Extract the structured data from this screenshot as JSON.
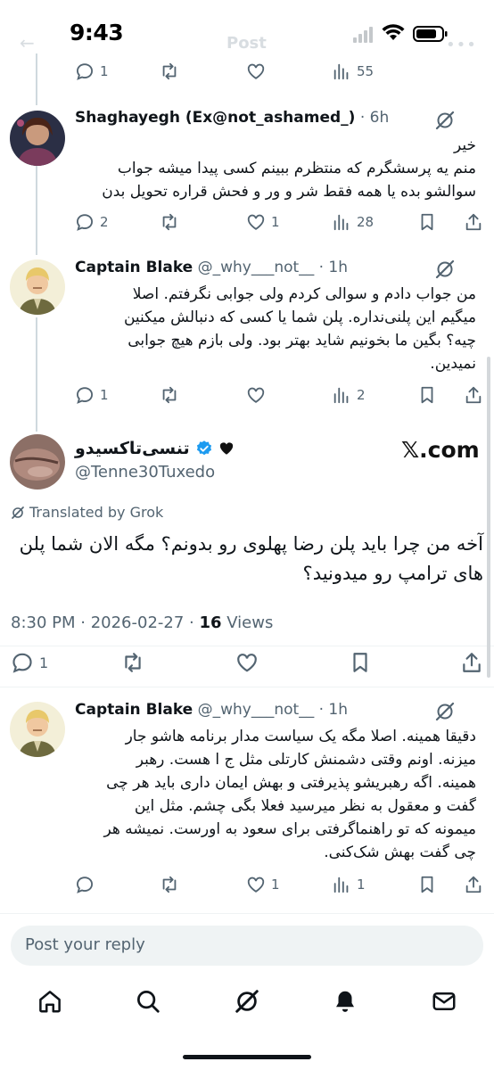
{
  "status_bar": {
    "time": "9:43",
    "icons": [
      "cellular-signal-icon",
      "wifi-icon",
      "battery-icon"
    ]
  },
  "header": {
    "title": "Post"
  },
  "top_partial_actions": {
    "reply_count": "1",
    "views_count": "55"
  },
  "replies_above": [
    {
      "name": "Shaghayegh (Ex@not_ashamed_)",
      "time": "6h",
      "text_lines": [
        "خیر",
        "منم یه پرسشگرم که منتظرم ببینم کسی پیدا میشه جواب",
        "سوالشو بده یا همه فقط شر و ور و فحش قراره تحویل بدن"
      ],
      "reply_count": "2",
      "repost_count": "",
      "like_count": "1",
      "views_count": "28"
    },
    {
      "name": "Captain Blake",
      "handle": "@_why___not__",
      "time": "1h",
      "text_lines": [
        "من جواب دادم و سوالی کردم ولی جوابی نگرفتم. اصلا",
        "میگیم این پلنی‌نداره. پلن شما یا کسی که دنبالش میکنین",
        "چیه؟ بگین ما بخونیم شاید بهتر بود. ولی بازم هیچ جوابی",
        "نمیدین."
      ],
      "reply_count": "1",
      "repost_count": "",
      "like_count": "",
      "views_count": "2"
    }
  ],
  "main_tweet": {
    "name": "تنسی‌تاکسیدو",
    "handle": "@Tenne30Tuxedo",
    "watermark": "𝕏.com",
    "translated_label": "Translated by Grok",
    "text": "آخه من چرا باید پلن رضا پهلوی رو بدونم؟ مگه الان شما پلن های ترامپ رو میدونید؟",
    "timestamp": "8:30 PM · 2026-02-27 · ",
    "views_count": "16",
    "views_label": " Views",
    "reply_count": "1"
  },
  "reply_below": {
    "name": "Captain Blake",
    "handle": "@_why___not__",
    "time": "1h",
    "text_lines": [
      "دقیقا همینه. اصلا مگه یک سیاست مدار برنامه هاشو جار",
      "میزنه. اونم وقتی دشمنش کارتلی مثل ج ا هست. رهبر",
      "همینه. اگه رهبریشو پذیرفتی و بهش ایمان داری باید هر چی",
      "گفت و معقول به نظر میرسید فعلا بگی چشم. مثل این",
      "میمونه که تو راهنماگرفتی برای سعود به اورست. نمیشه هر",
      "چی گفت بهش شک‌کنی."
    ],
    "reply_count": "",
    "repost_count": "",
    "like_count": "1",
    "views_count": "1"
  },
  "reply_input": {
    "placeholder": "Post your reply"
  },
  "bottom_nav": [
    "home-icon",
    "search-icon",
    "grok-icon",
    "notifications-icon",
    "messages-icon"
  ],
  "colors": {
    "text_primary": "#0f1419",
    "text_secondary": "#536471",
    "verified_blue": "#1d9bf0",
    "divider": "#eff3f4"
  }
}
